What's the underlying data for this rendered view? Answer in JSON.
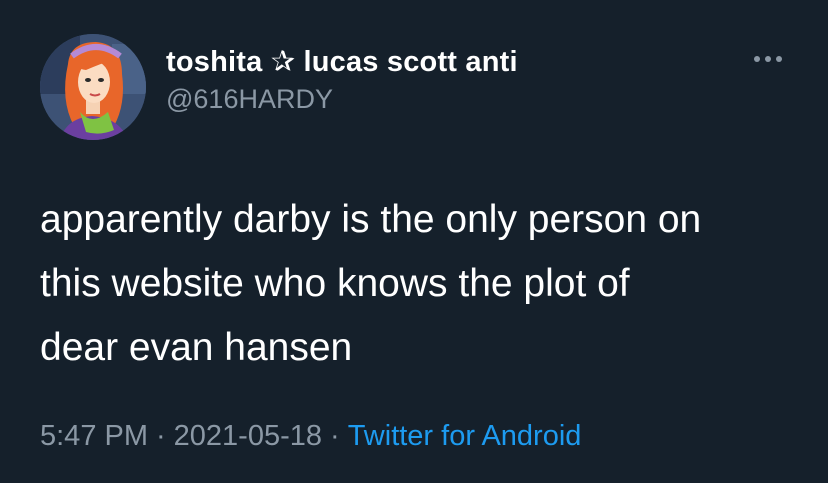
{
  "user": {
    "display_name": "toshita ✰ lucas scott anti",
    "handle": "@616HARDY",
    "avatar_icon": "daphne-avatar"
  },
  "actions": {
    "more_icon": "more-horizontal-icon"
  },
  "tweet": {
    "text": "apparently darby is the only person on\nthis website who knows the plot of\ndear evan hansen"
  },
  "meta": {
    "time": "5:47 PM",
    "separator": "·",
    "date": "2021-05-18",
    "source": "Twitter for Android"
  },
  "colors": {
    "background": "#15202b",
    "text_primary": "#ffffff",
    "text_secondary": "#8b98a5",
    "link": "#1d9bf0"
  }
}
